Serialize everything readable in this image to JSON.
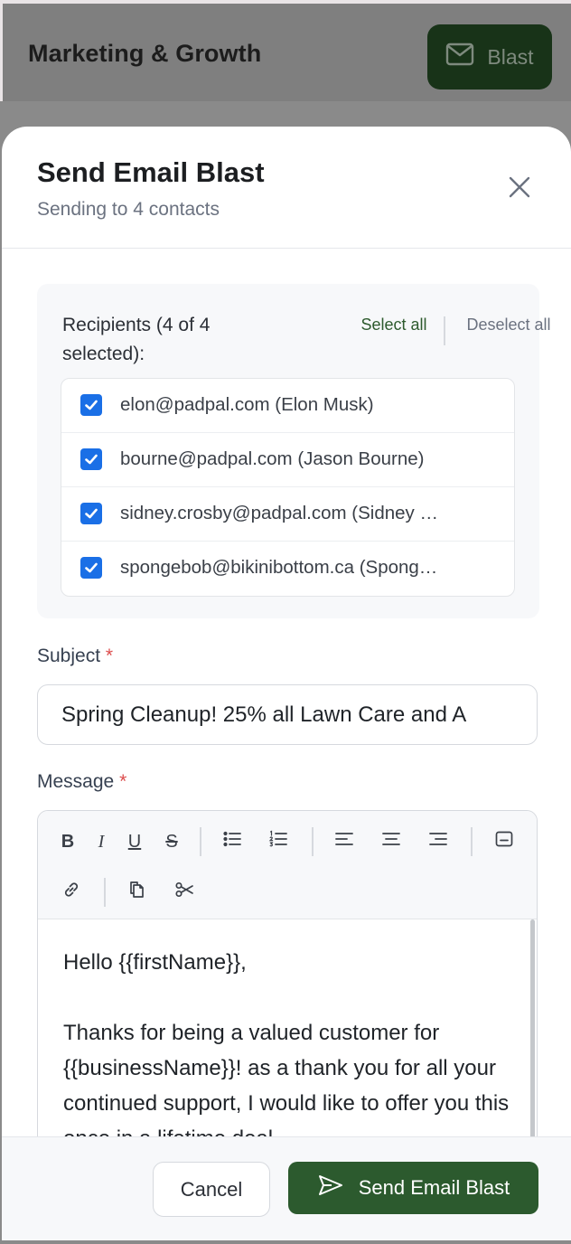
{
  "background": {
    "title": "Marketing & Growth",
    "blast_button_label": "Blast",
    "blast_icon": "mail-icon"
  },
  "modal": {
    "title": "Send Email Blast",
    "subtitle": "Sending to 4 contacts",
    "close_icon": "close-icon"
  },
  "recipients": {
    "label": "Recipients (4 of 4 selected):",
    "select_all": "Select all",
    "deselect_all": "Deselect all",
    "items": [
      {
        "text": "elon@padpal.com (Elon Musk)",
        "checked": true
      },
      {
        "text": "bourne@padpal.com (Jason Bourne)",
        "checked": true
      },
      {
        "text": "sidney.crosby@padpal.com (Sidney …",
        "checked": true
      },
      {
        "text": "spongebob@bikinibottom.ca (Spong…",
        "checked": true
      }
    ]
  },
  "subject": {
    "label": "Subject",
    "required_mark": "*",
    "value": "Spring Cleanup! 25% all Lawn Care and A"
  },
  "message": {
    "label": "Message",
    "required_mark": "*",
    "toolbar": {
      "bold": "B",
      "italic": "I",
      "underline": "U",
      "strike": "S",
      "icons": [
        "bullet-list-icon",
        "numbered-list-icon",
        "align-left-icon",
        "align-center-icon",
        "align-right-icon",
        "placeholder-icon",
        "link-icon",
        "copy-icon",
        "cut-icon"
      ]
    },
    "body_line_1": "Hello {{firstName}},",
    "body_line_2": "Thanks for being a valued customer for {{businessName}}! as a thank you for all your continued support, I would like to offer you this once in a lifetime deal"
  },
  "footer": {
    "cancel_label": "Cancel",
    "send_label": "Send Email Blast",
    "send_icon": "send-icon"
  },
  "colors": {
    "accent_green": "#2c5a2e",
    "checkbox_blue": "#1a6fe6",
    "required_red": "#dc4d4d"
  }
}
